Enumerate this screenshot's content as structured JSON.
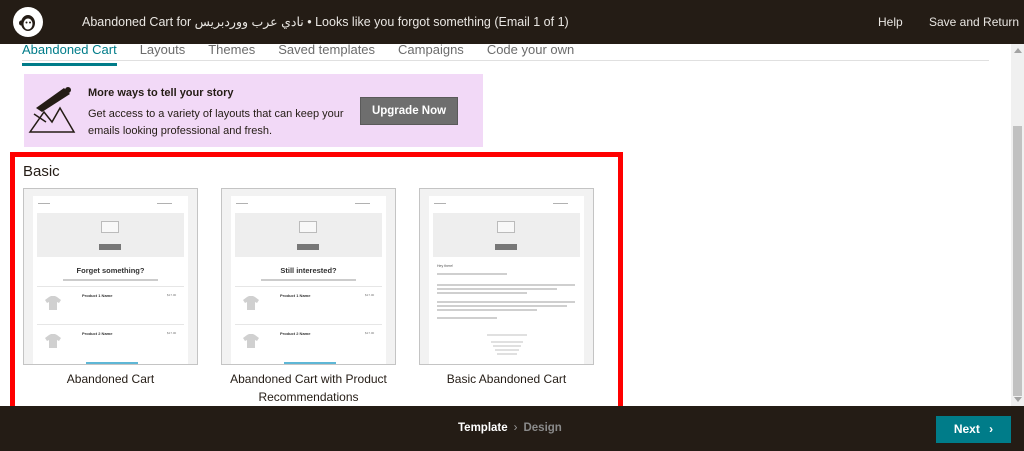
{
  "header": {
    "title": "Abandoned Cart for نادي عرب ووردبريس • Looks like you forgot something (Email 1 of 1)",
    "help_label": "Help",
    "save_return_label": "Save and Return",
    "logo_icon": "mailchimp-freddie-icon"
  },
  "tabs": [
    {
      "label": "Abandoned Cart",
      "active": true
    },
    {
      "label": "Layouts",
      "active": false
    },
    {
      "label": "Themes",
      "active": false
    },
    {
      "label": "Saved templates",
      "active": false
    },
    {
      "label": "Campaigns",
      "active": false
    },
    {
      "label": "Code your own",
      "active": false
    }
  ],
  "promo": {
    "title": "More ways to tell your story",
    "body": "Get access to a variety of layouts that can keep your emails looking professional and fresh.",
    "button_label": "Upgrade Now",
    "background": "#f2d9f7"
  },
  "section": {
    "title": "Basic"
  },
  "templates": [
    {
      "label": "Abandoned Cart",
      "preview": {
        "heading": "Forget something?",
        "products": [
          {
            "name": "Product 1 Name",
            "price": "$17.00"
          },
          {
            "name": "Product 2 Name",
            "price": "$17.00"
          }
        ]
      }
    },
    {
      "label": "Abandoned Cart with Product Recommendations",
      "preview": {
        "heading": "Still interested?",
        "products": [
          {
            "name": "Product 1 Name",
            "price": "$17.00"
          },
          {
            "name": "Product 2 Name",
            "price": "$17.00"
          }
        ]
      }
    },
    {
      "label": "Basic Abandoned Cart",
      "preview": {
        "greeting": "Hey there!"
      }
    }
  ],
  "footer": {
    "step_template": "Template",
    "step_design": "Design",
    "next_label": "Next",
    "accent": "#007c89"
  },
  "colors": {
    "header_bg": "#241c15",
    "highlight_border": "#ff0000"
  }
}
